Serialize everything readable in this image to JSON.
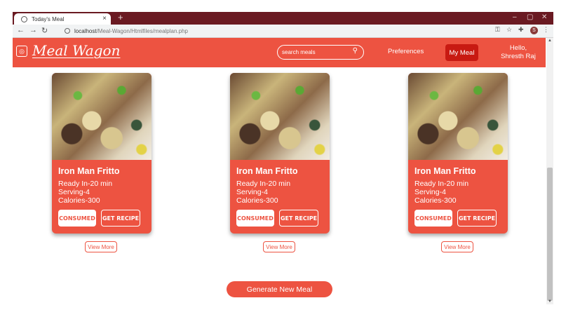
{
  "browser": {
    "tab_title": "Today's Meal",
    "tab_close": "×",
    "new_tab": "+",
    "url_host": "localhost",
    "url_path": "/Meal-Wagon/Htmlfiles/mealplan.php",
    "profile_initial": "S",
    "window_controls": [
      "–",
      "▢",
      "✕"
    ]
  },
  "header": {
    "logo_text": "Meal Wagon",
    "search_placeholder": "search meals",
    "preferences_label": "Preferences",
    "my_meal_label": "My Meal",
    "greeting_line1": "Hello,",
    "greeting_line2": "Shresth Raj"
  },
  "meals": [
    {
      "title": "Iron Man Fritto",
      "ready": "Ready In-20 min",
      "serving": "Serving-4",
      "calories": "Calories-300",
      "consumed_label": "CONSUMED",
      "recipe_label": "GET RECIPE",
      "view_more": "View More"
    },
    {
      "title": "Iron Man Fritto",
      "ready": "Ready In-20 min",
      "serving": "Serving-4",
      "calories": "Calories-300",
      "consumed_label": "CONSUMED",
      "recipe_label": "GET RECIPE",
      "view_more": "View More"
    },
    {
      "title": "Iron Man Fritto",
      "ready": "Ready In-20 min",
      "serving": "Serving-4",
      "calories": "Calories-300",
      "consumed_label": "CONSUMED",
      "recipe_label": "GET RECIPE",
      "view_more": "View More"
    }
  ],
  "generate_label": "Generate New Meal",
  "colors": {
    "accent": "#ed5341",
    "dark_accent": "#c81a12",
    "titlebar": "#6a1a22"
  }
}
